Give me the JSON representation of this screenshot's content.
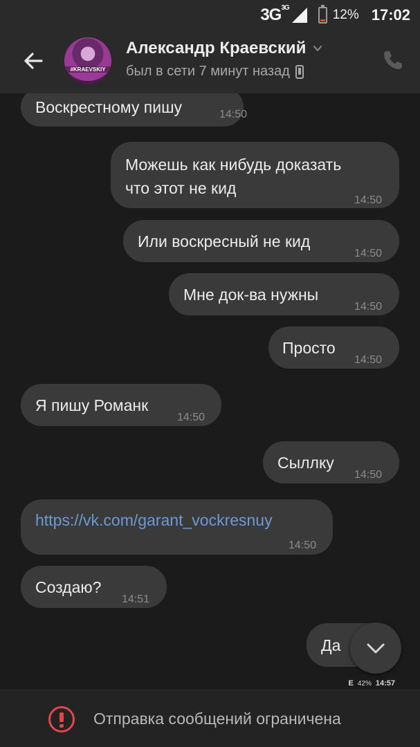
{
  "status_bar": {
    "network": "3G",
    "network_sup": "3G",
    "battery_percent": "12%",
    "time": "17:02"
  },
  "header": {
    "contact_name": "Александр Краевский",
    "last_seen": "был в сети 7 минут назад",
    "avatar_text": "#KRAEVSKIY"
  },
  "messages": [
    {
      "side": "in",
      "text": "Воскрестному пишу",
      "time": "14:50"
    },
    {
      "side": "out",
      "text": "Можешь как нибудь доказать что этот не кид",
      "line1": "Можешь как нибудь доказать",
      "line2": "что этот не кид",
      "time": "14:50"
    },
    {
      "side": "out",
      "text": "Или воскресный не кид",
      "time": "14:50"
    },
    {
      "side": "out",
      "text": "Мне док-ва нужны",
      "time": "14:50"
    },
    {
      "side": "out",
      "text": "Просто",
      "time": "14:50"
    },
    {
      "side": "in",
      "text": "Я пишу Романк",
      "time": "14:50"
    },
    {
      "side": "out",
      "text": "Сыллку",
      "time": "14:50"
    },
    {
      "side": "in",
      "text": "https://vk.com/garant_vockresnuy",
      "time": "14:50",
      "is_link": true
    },
    {
      "side": "in",
      "text": "Создаю?",
      "time": "14:51"
    },
    {
      "side": "out",
      "text": "Да",
      "time": ""
    }
  ],
  "embedded_status": {
    "network": "E",
    "battery_percent": "42%",
    "time": "14:57"
  },
  "footer": {
    "restriction_text": "Отправка сообщений ограничена"
  },
  "colors": {
    "background": "#1b1b1b",
    "bar": "#2a2a2a",
    "bubble": "#3a3a3a",
    "link": "#6d9ad6",
    "warning": "#e64646",
    "battery_low": "#e04a2a"
  }
}
